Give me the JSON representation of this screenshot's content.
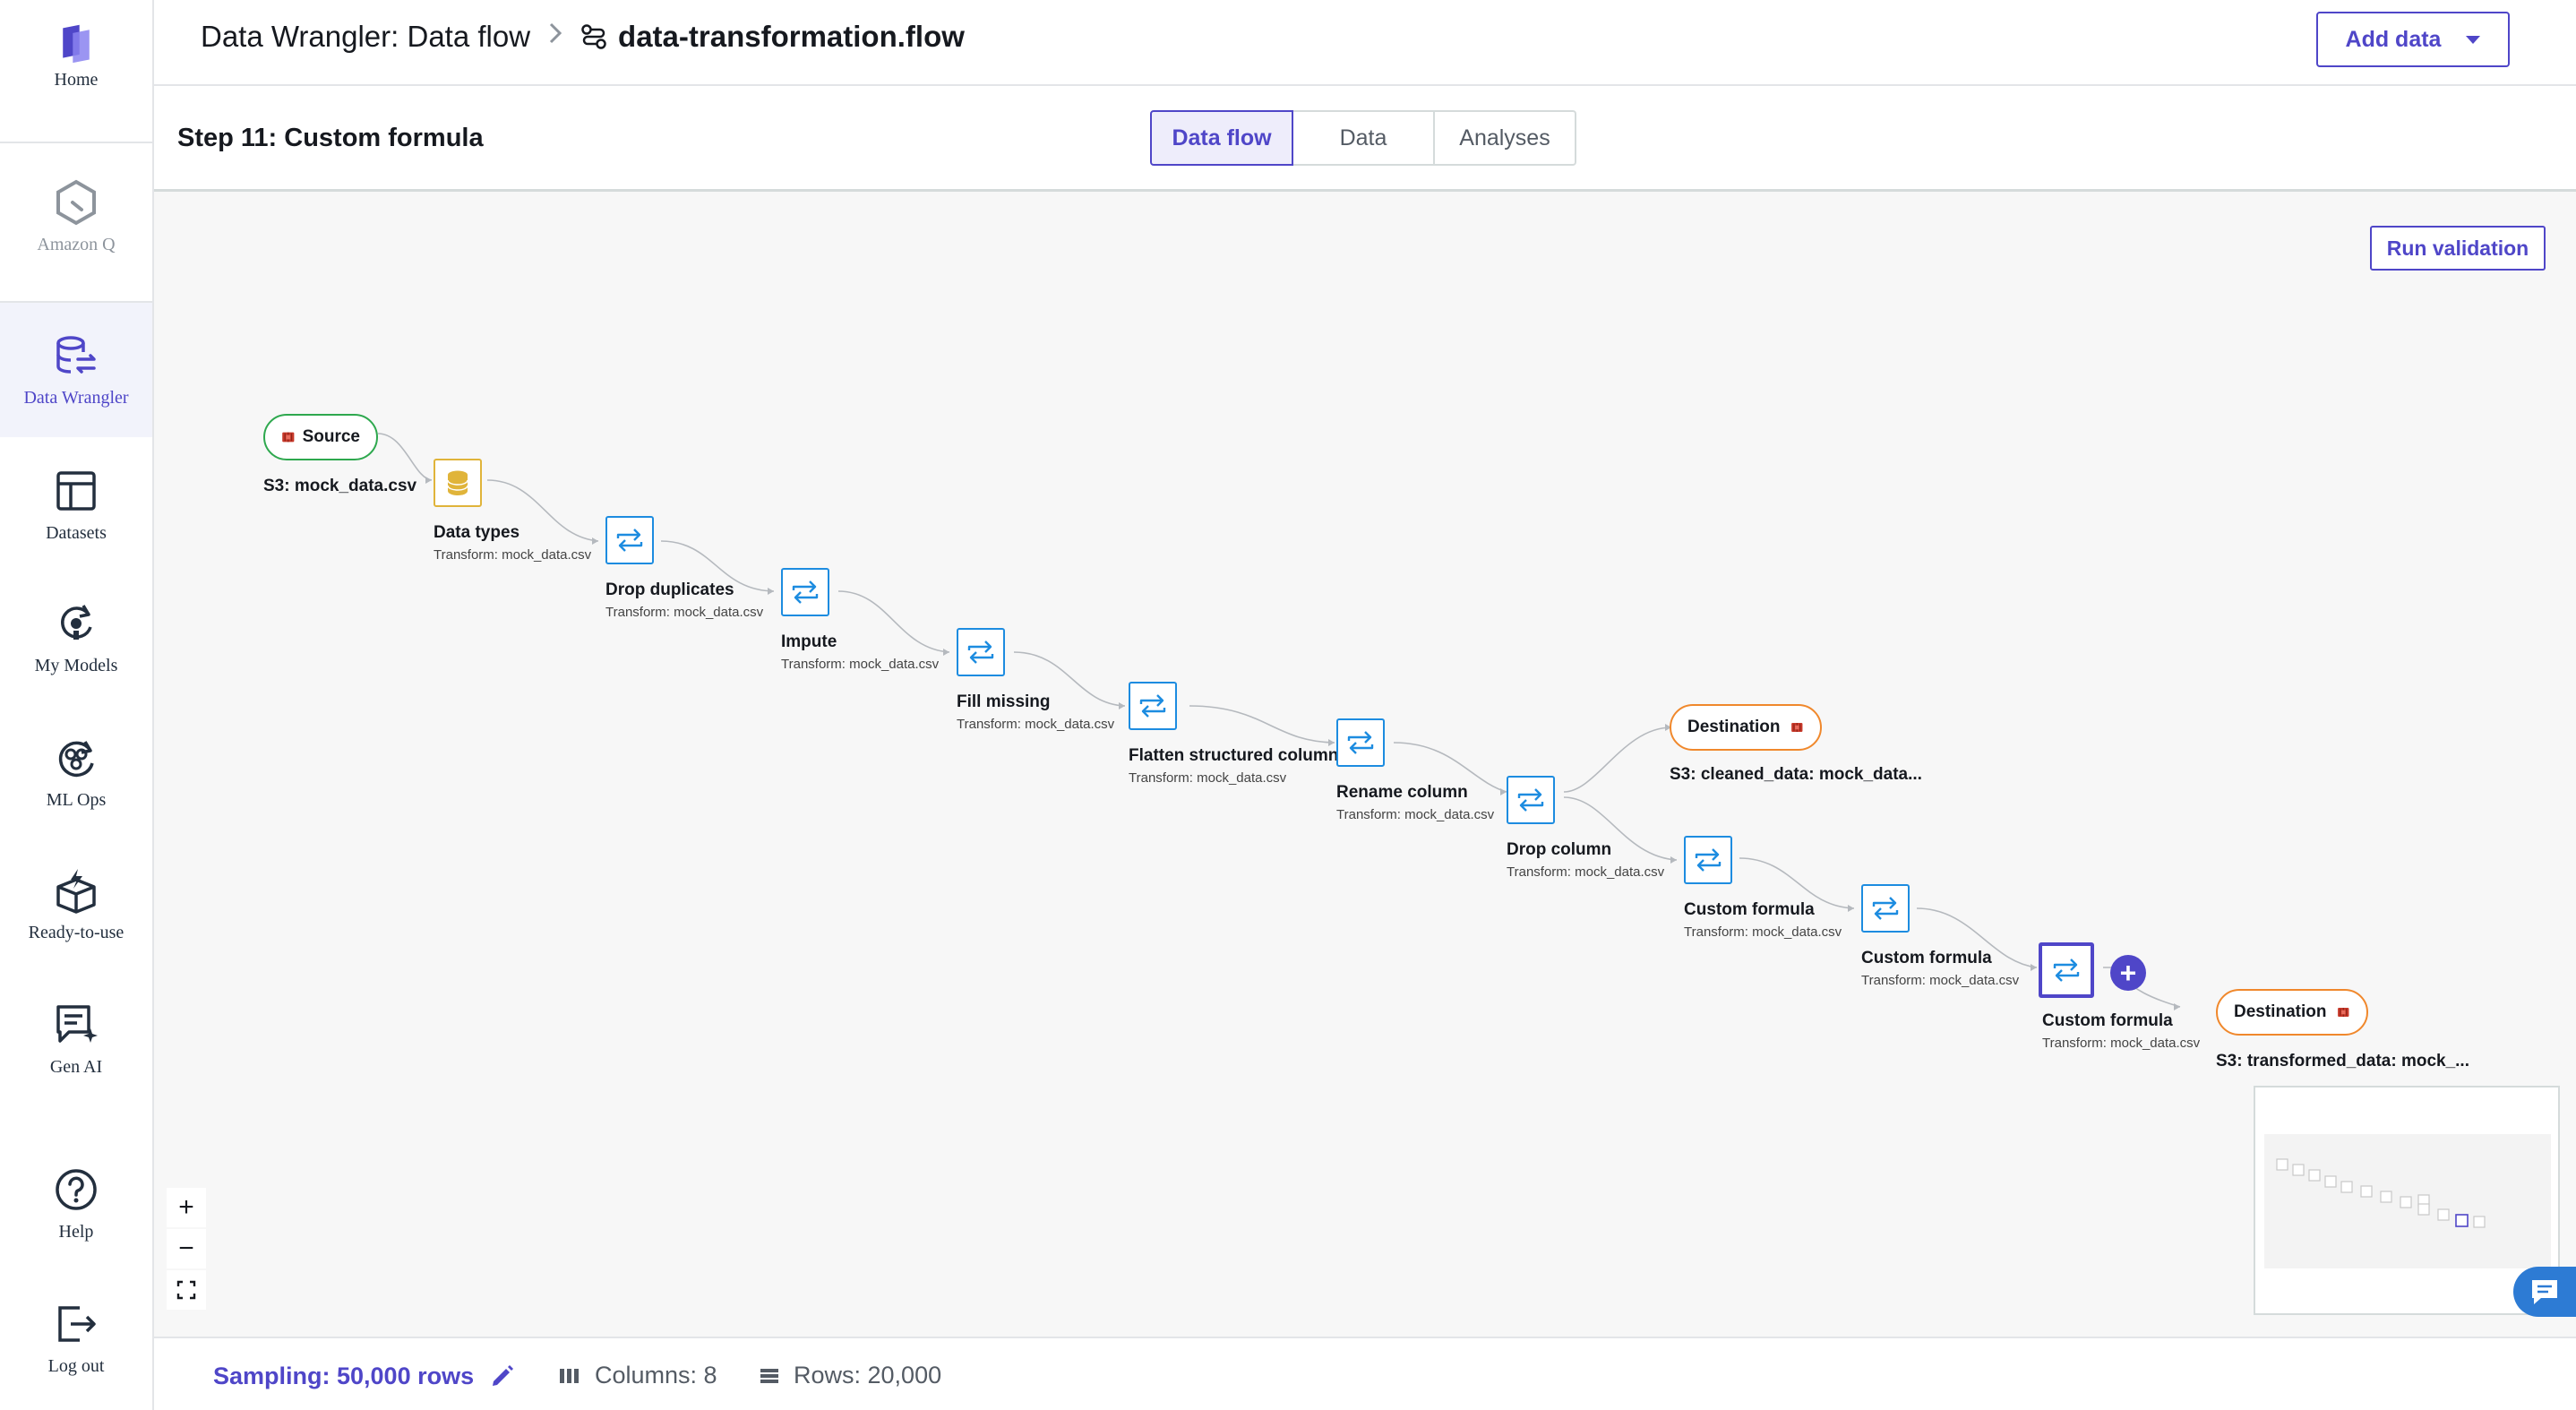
{
  "rail": {
    "home": "Home",
    "amazon_q": "Amazon Q",
    "data_wrangler": "Data Wrangler",
    "datasets": "Datasets",
    "my_models": "My Models",
    "ml_ops": "ML Ops",
    "ready_to_use": "Ready-to-use",
    "gen_ai": "Gen AI",
    "help": "Help",
    "log_out": "Log out"
  },
  "header": {
    "crumb_root": "Data Wrangler: Data flow",
    "crumb_file": "data-transformation.flow",
    "add_data": "Add data"
  },
  "subheader": {
    "step_title": "Step 11: Custom formula",
    "tabs": [
      "Data flow",
      "Data",
      "Analyses"
    ]
  },
  "canvas": {
    "run_validation": "Run validation",
    "source": {
      "label": "Source",
      "caption": "S3: mock_data.csv"
    },
    "nodes": [
      {
        "title": "Data types",
        "sub": "Transform: mock_data.csv"
      },
      {
        "title": "Drop duplicates",
        "sub": "Transform: mock_data.csv"
      },
      {
        "title": "Impute",
        "sub": "Transform: mock_data.csv"
      },
      {
        "title": "Fill missing",
        "sub": "Transform: mock_data.csv"
      },
      {
        "title": "Flatten structured column",
        "sub": "Transform: mock_data.csv"
      },
      {
        "title": "Rename column",
        "sub": "Transform: mock_data.csv"
      },
      {
        "title": "Drop column",
        "sub": "Transform: mock_data.csv"
      },
      {
        "title": "Custom formula",
        "sub": "Transform: mock_data.csv"
      },
      {
        "title": "Custom formula",
        "sub": "Transform: mock_data.csv"
      },
      {
        "title": "Custom formula",
        "sub": "Transform: mock_data.csv"
      }
    ],
    "dest1": {
      "label": "Destination",
      "caption": "S3: cleaned_data: mock_data..."
    },
    "dest2": {
      "label": "Destination",
      "caption": "S3: transformed_data: mock_..."
    },
    "zoom_in": "+",
    "zoom_out": "−"
  },
  "footer": {
    "sampling": "Sampling: 50,000 rows",
    "columns": "Columns: 8",
    "rows": "Rows: 20,000"
  },
  "colors": {
    "accent": "#4f46c8",
    "transform_border": "#1d8ce0",
    "source_border": "#2ea84e",
    "destination_border": "#f0882c"
  }
}
